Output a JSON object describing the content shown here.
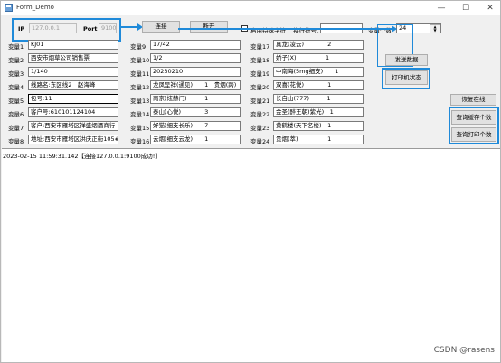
{
  "window": {
    "title": "Form_Demo",
    "minimize": "—",
    "maximize": "☐",
    "close": "✕"
  },
  "connection": {
    "ip_label": "IP",
    "ip_value": "127.0.0.1",
    "port_label": "Port",
    "port_value": "9100",
    "connect_label": "连接",
    "disconnect_label": "断开"
  },
  "options": {
    "checkbox_label": "启用特殊字符",
    "sep_label": "换行符号：",
    "sep_value": "",
    "var_count_label": "变量个数",
    "var_count_value": "24"
  },
  "variables_col1": [
    {
      "label": "变量1",
      "value": "KJ01"
    },
    {
      "label": "变量2",
      "value": "西安市烟草公司销售票"
    },
    {
      "label": "变量3",
      "value": "1/140"
    },
    {
      "label": "变量4",
      "value": "线路名:东区线2　赵海峰"
    },
    {
      "label": "变量5",
      "value": "包号:11"
    },
    {
      "label": "变量6",
      "value": "客户号:610101124104"
    },
    {
      "label": "变量7",
      "value": "客户:西安市雁塔区祥盛烟酒商行"
    },
    {
      "label": "变量8",
      "value": "地址:西安市雁塔区洪庆正街105#"
    }
  ],
  "variables_col2": [
    {
      "label": "变量9",
      "value": "17/42"
    },
    {
      "label": "变量10",
      "value": "1/2"
    },
    {
      "label": "变量11",
      "value": "20230210"
    },
    {
      "label": "变量12",
      "value": "龙凤呈祥(通见)　　1　贵烟(跨)"
    },
    {
      "label": "变量13",
      "value": "南京(炫赫门)　　　1"
    },
    {
      "label": "变量14",
      "value": "泰山(心悦)　　　　3"
    },
    {
      "label": "变量15",
      "value": "好猫(细支长乐)　　7"
    },
    {
      "label": "变量16",
      "value": "云烟(细支云龙)　　1"
    }
  ],
  "variables_col3": [
    {
      "label": "变量17",
      "value": "真龙(凌云)　　　　2"
    },
    {
      "label": "变量18",
      "value": "娇子(X)　　　　　1"
    },
    {
      "label": "变量19",
      "value": "中南海(5mg细支)　　1"
    },
    {
      "label": "变量20",
      "value": "双喜(花悦)　　　　1"
    },
    {
      "label": "变量21",
      "value": "长白山(777)　　　1"
    },
    {
      "label": "变量22",
      "value": "金圣(醉王朝)紫光)　1"
    },
    {
      "label": "变量23",
      "value": "黄鹤楼(天下名楼)　1"
    },
    {
      "label": "变量24",
      "value": "贵烟(萃)　　　　　1"
    }
  ],
  "actions": {
    "send": "发送数据",
    "printer_status": "打印机状态",
    "recover": "恢复在线",
    "query_cache": "查询缓存个数",
    "query_print": "查询打印个数"
  },
  "log": {
    "line": "2023-02-15 11:59:31.142【连接127.0.0.1:9100成功!】"
  },
  "watermark": "CSDN @rasens",
  "colors": {
    "highlight": "#1f8ad9"
  }
}
